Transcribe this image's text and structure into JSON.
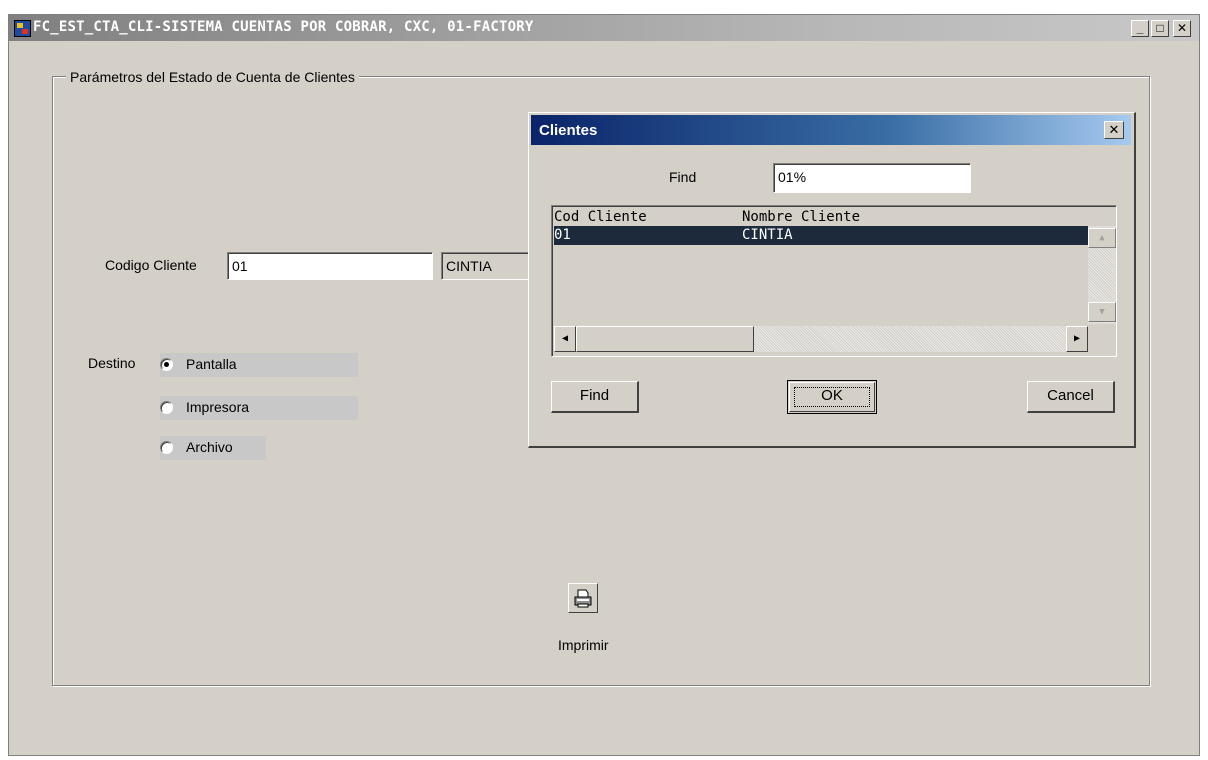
{
  "window": {
    "title": "FC_EST_CTA_CLI-SISTEMA CUENTAS POR COBRAR, CXC, 01-FACTORY",
    "controls": {
      "minimize": "_",
      "maximize": "□",
      "close": "✕"
    }
  },
  "group": {
    "legend": "Parámetros del Estado de Cuenta de Clientes"
  },
  "form": {
    "codigo_cliente_label": "Codigo Cliente",
    "codigo_cliente_value": "01",
    "cliente_name_value": "CINTIA",
    "destino_label": "Destino",
    "destino_options": [
      {
        "label": "Pantalla",
        "selected": true
      },
      {
        "label": "Impresora",
        "selected": false
      },
      {
        "label": "Archivo",
        "selected": false
      }
    ],
    "print_label": "Imprimir",
    "print_icon": "printer-icon"
  },
  "dialog": {
    "title": "Clientes",
    "close": "✕",
    "find_label": "Find",
    "find_value": "01%",
    "columns": [
      "Cod Cliente",
      "Nombre Cliente"
    ],
    "rows": [
      {
        "cod": "01",
        "nombre": "CINTIA",
        "selected": true
      }
    ],
    "buttons": {
      "find": "Find",
      "ok": "OK",
      "cancel": "Cancel"
    }
  },
  "colors": {
    "window_bg": "#d4d0c8",
    "dialog_title_start": "#0a246a",
    "dialog_title_end": "#a6caf0",
    "selected_row": "#1c2a3c"
  }
}
